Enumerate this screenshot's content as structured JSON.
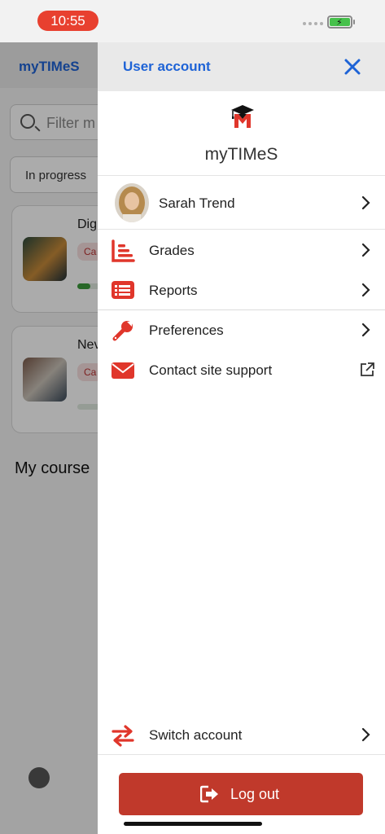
{
  "status_bar": {
    "time": "10:55"
  },
  "background": {
    "app_title": "myTIMeS",
    "search_placeholder": "Filter m",
    "filter_label": "In progress",
    "courses": [
      {
        "title_fragment": "Dig",
        "badge_fragment": "Ca"
      },
      {
        "title_fragment": "Nev",
        "badge_fragment": "Ca"
      }
    ],
    "section_title": "My course"
  },
  "drawer": {
    "title": "User account",
    "site_name": "myTIMeS",
    "user_name": "Sarah Trend",
    "menu": [
      {
        "label": "Grades",
        "icon": "grades-icon"
      },
      {
        "label": "Reports",
        "icon": "reports-icon"
      },
      {
        "label": "Preferences",
        "icon": "wrench-icon"
      },
      {
        "label": "Contact site support",
        "icon": "envelope-icon"
      }
    ],
    "switch_account": "Switch account",
    "logout": "Log out"
  },
  "colors": {
    "accent_blue": "#1e63d6",
    "brand_red": "#e0362b",
    "logout_red": "#c0392b"
  }
}
